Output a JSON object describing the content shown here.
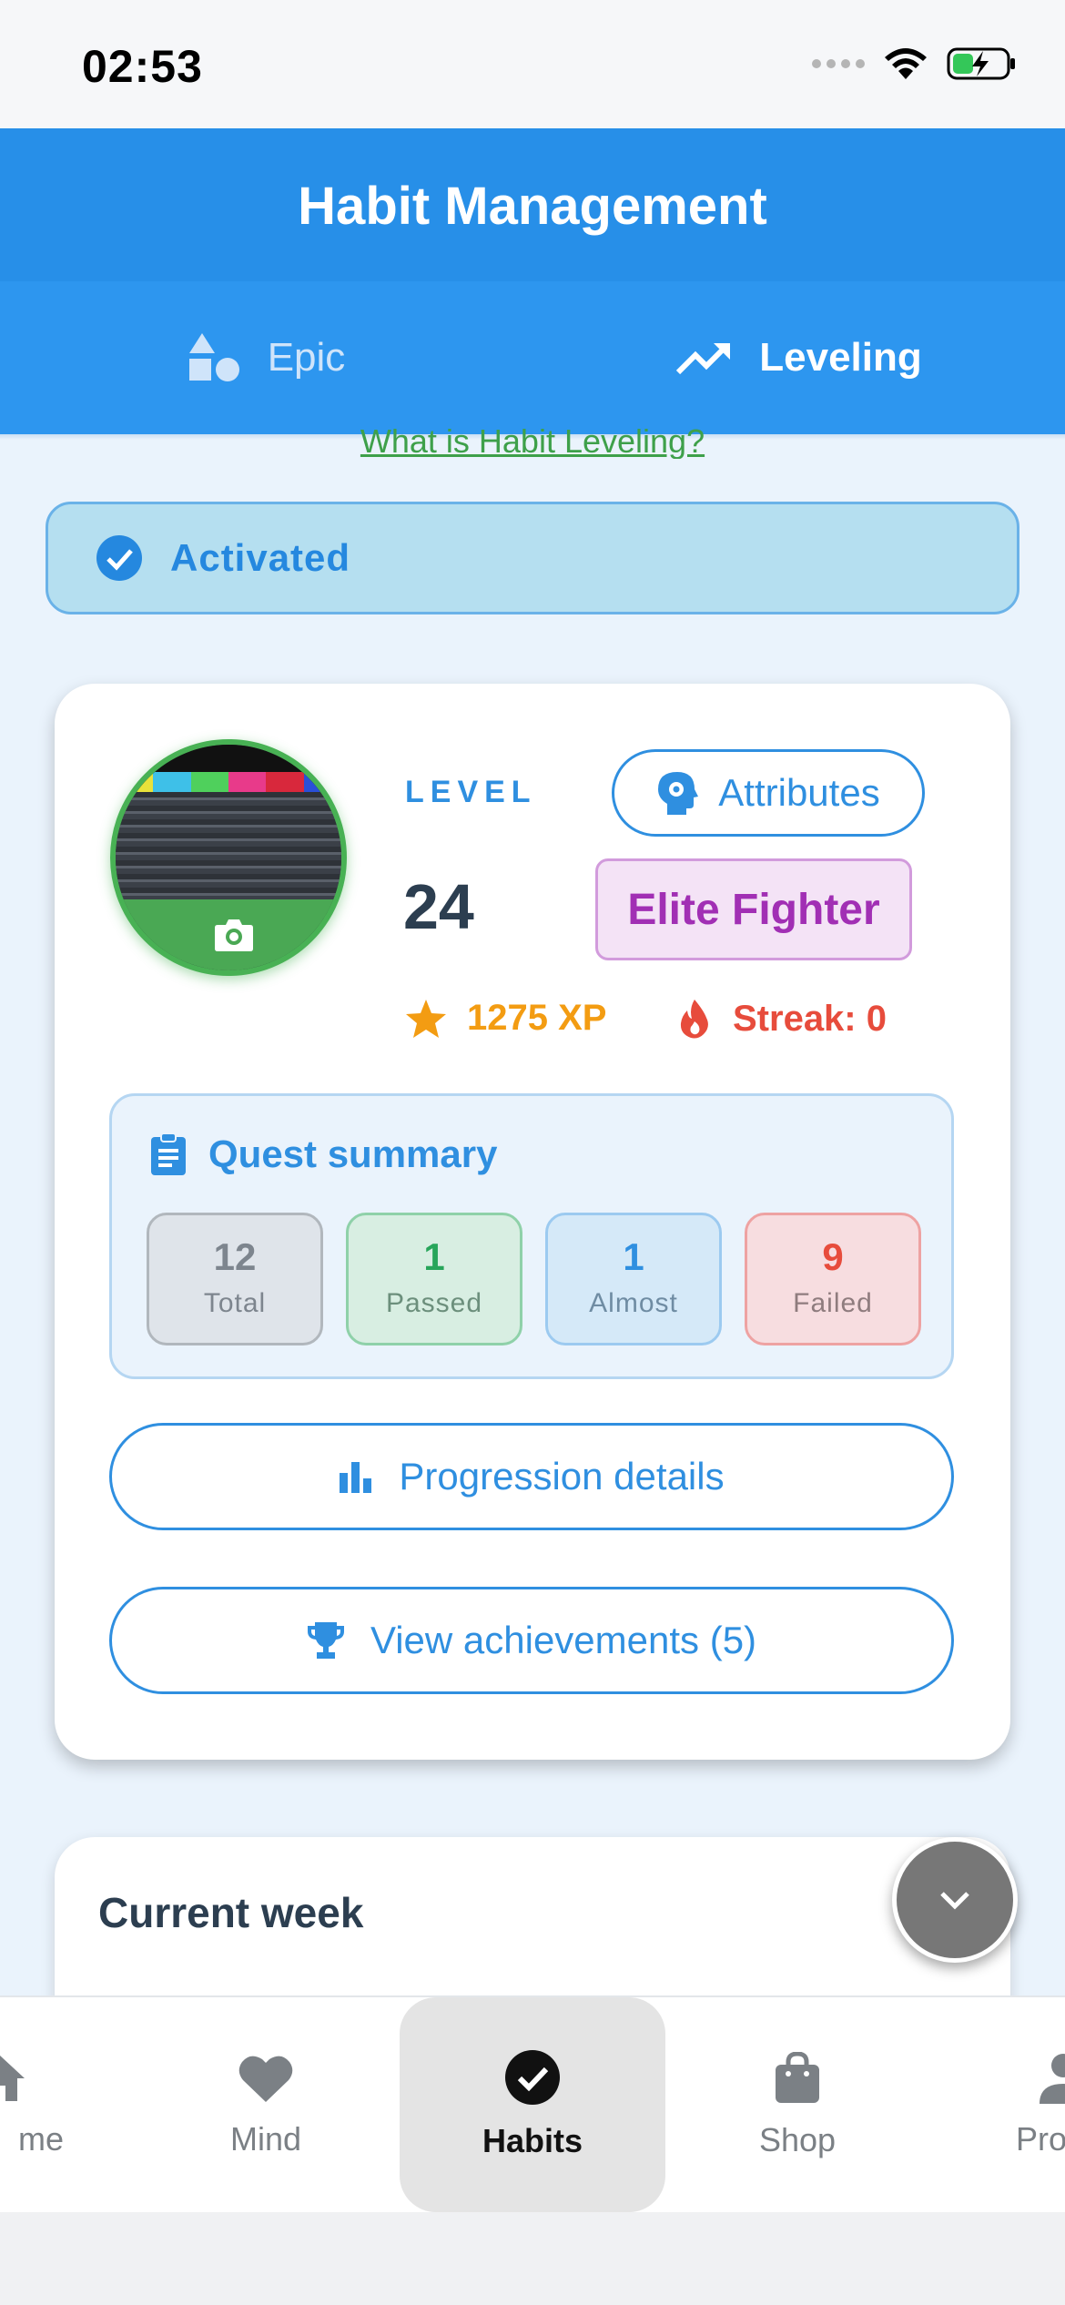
{
  "status_bar": {
    "time": "02:53"
  },
  "app_bar": {
    "title": "Habit Management"
  },
  "tabs": [
    {
      "label": "Epic",
      "icon": "shapes-icon",
      "active": false
    },
    {
      "label": "Leveling",
      "icon": "trending-up-icon",
      "active": true
    }
  ],
  "help_link": "What is Habit Leveling?",
  "activation": {
    "label": "Activated"
  },
  "level_card": {
    "level_label": "LEVEL",
    "level_value": "24",
    "attributes_label": "Attributes",
    "rank": "Elite Fighter",
    "xp": "1275 XP",
    "streak": "Streak: 0",
    "quest_summary": {
      "title": "Quest summary",
      "stats": [
        {
          "value": "12",
          "label": "Total"
        },
        {
          "value": "1",
          "label": "Passed"
        },
        {
          "value": "1",
          "label": "Almost"
        },
        {
          "value": "9",
          "label": "Failed"
        }
      ]
    },
    "progression_label": "Progression details",
    "achievements_label": "View achievements (5)"
  },
  "week_card": {
    "title": "Current week",
    "subtitle": ""
  },
  "bottom_nav": [
    {
      "label": "me",
      "icon": "home-icon"
    },
    {
      "label": "Mind",
      "icon": "heart-icon"
    },
    {
      "label": "Habits",
      "icon": "check-circle-icon",
      "active": true
    },
    {
      "label": "Shop",
      "icon": "shopping-bag-icon"
    },
    {
      "label": "Pro",
      "icon": "person-icon"
    }
  ],
  "colors": {
    "primary": "#278fe8",
    "accent_blue": "#2f8fe0",
    "success": "#27a55a",
    "danger": "#e74c3c",
    "xp": "#f39c12",
    "rank": "#a12fb4"
  }
}
